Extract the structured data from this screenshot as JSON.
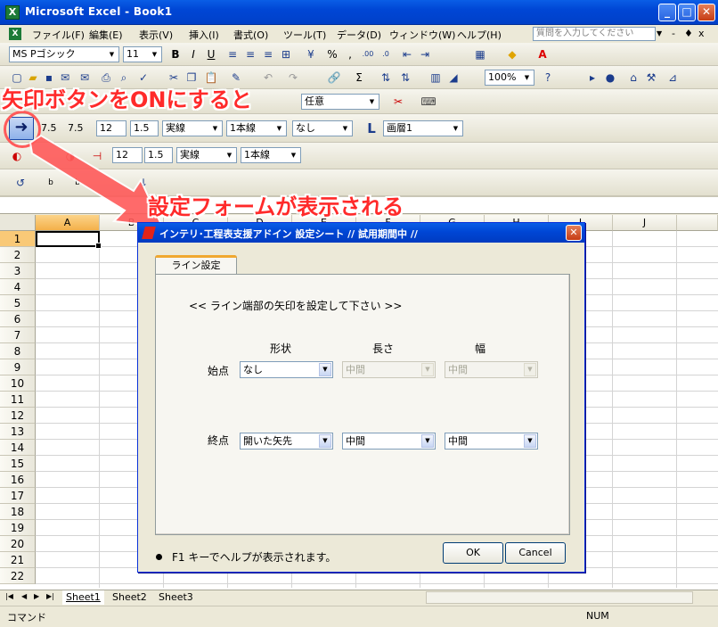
{
  "window": {
    "title": "Microsoft Excel - Book1",
    "app_icon": "excel-icon",
    "controls": [
      "_",
      "□",
      "✕"
    ]
  },
  "menu": {
    "items": [
      "ファイル(F)",
      "編集(E)",
      "表示(V)",
      "挿入(I)",
      "書式(O)",
      "ツール(T)",
      "データ(D)",
      "ウィンドウ(W)",
      "ヘルプ(H)"
    ],
    "help_placeholder": "質問を入力してください",
    "mdi_controls": [
      "-",
      "♦",
      "x"
    ]
  },
  "format_toolbar": {
    "font_name": "MS Pゴシック",
    "font_size": "11",
    "zoom": "100%"
  },
  "addin_toolbar_1": {
    "style_combo": "任意"
  },
  "addin_toolbar_2": {
    "val1": "7.5",
    "val2": "7.5",
    "val3": "12",
    "val4": "1.5",
    "line_style": "実線",
    "line_count": "1本線",
    "fill": "なし",
    "layer": "画層1"
  },
  "addin_toolbar_3": {
    "val1": "12",
    "val2": "1.5",
    "line_style": "実線",
    "line_count": "1本線"
  },
  "annotations": {
    "top": "矢印ボタンをONにすると",
    "middle": "設定フォームが表示される",
    "color": "#ff2a2a"
  },
  "grid": {
    "columns": [
      "A",
      "B",
      "C",
      "D",
      "E",
      "F",
      "G",
      "H",
      "I",
      "J"
    ],
    "rows": [
      "1",
      "2",
      "3",
      "4",
      "5",
      "6",
      "7",
      "8",
      "9",
      "10",
      "11",
      "12",
      "13",
      "14",
      "15",
      "16",
      "17",
      "18",
      "19",
      "20",
      "21",
      "22"
    ],
    "active_cell": "A1"
  },
  "sheets": {
    "tabs": [
      "Sheet1",
      "Sheet2",
      "Sheet3"
    ],
    "active": "Sheet1"
  },
  "status": {
    "mode": "コマンド",
    "num": "NUM"
  },
  "dialog": {
    "title": "インテリ･工程表支援アドイン 設定シート // 試用期間中 //",
    "tab": "ライン設定",
    "heading": "<< ライン端部の矢印を設定して下さい >>",
    "col_shape": "形状",
    "col_length": "長さ",
    "col_width": "幅",
    "start_label": "始点",
    "end_label": "終点",
    "start_shape": "なし",
    "start_length": "中間",
    "start_width": "中間",
    "end_shape": "開いた矢先",
    "end_length": "中間",
    "end_width": "中間",
    "ok": "OK",
    "cancel": "Cancel",
    "help_note": "F1 キーでヘルプが表示されます。"
  }
}
